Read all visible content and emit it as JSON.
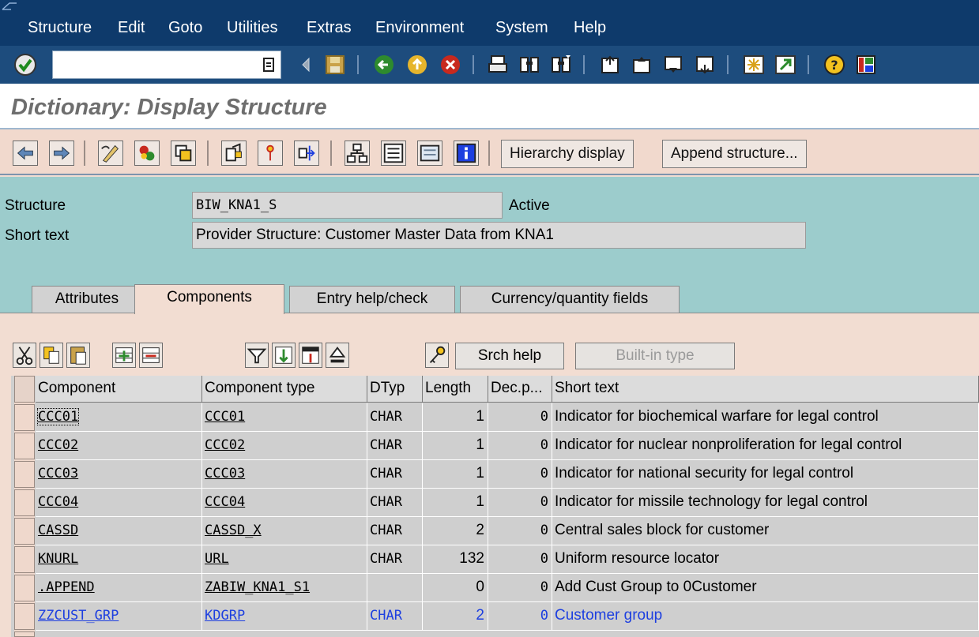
{
  "menu": {
    "items": [
      "Structure",
      "Edit",
      "Goto",
      "Utilities",
      "Extras",
      "Environment",
      "System",
      "Help"
    ]
  },
  "title": "Dictionary: Display Structure",
  "app_toolbar": {
    "hierarchy_label": "Hierarchy display",
    "append_label": "Append structure..."
  },
  "header": {
    "structure_label": "Structure",
    "structure_value": "BIW_KNA1_S",
    "status": "Active",
    "short_text_label": "Short text",
    "short_text_value": "Provider Structure: Customer Master Data from KNA1"
  },
  "tabs": [
    "Attributes",
    "Components",
    "Entry help/check",
    "Currency/quantity fields"
  ],
  "table_toolbar": {
    "srch_help_label": "Srch help",
    "builtin_type_label": "Built-in type"
  },
  "columns": [
    "Component",
    "Component type",
    "DTyp",
    "Length",
    "Dec.p...",
    "Short text"
  ],
  "rows": [
    {
      "component": "CCC01",
      "type": "CCC01",
      "dtyp": "CHAR",
      "length": "1",
      "dec": "0",
      "text": "Indicator for biochemical warfare for legal control"
    },
    {
      "component": "CCC02",
      "type": "CCC02",
      "dtyp": "CHAR",
      "length": "1",
      "dec": "0",
      "text": "Indicator for nuclear nonproliferation for legal control"
    },
    {
      "component": "CCC03",
      "type": "CCC03",
      "dtyp": "CHAR",
      "length": "1",
      "dec": "0",
      "text": "Indicator for national security for legal control"
    },
    {
      "component": "CCC04",
      "type": "CCC04",
      "dtyp": "CHAR",
      "length": "1",
      "dec": "0",
      "text": "Indicator for missile technology for legal control"
    },
    {
      "component": "CASSD",
      "type": "CASSD_X",
      "dtyp": "CHAR",
      "length": "2",
      "dec": "0",
      "text": "Central sales block for customer"
    },
    {
      "component": "KNURL",
      "type": "URL",
      "dtyp": "CHAR",
      "length": "132",
      "dec": "0",
      "text": "Uniform resource locator"
    },
    {
      "component": ".APPEND",
      "type": "ZABIW_KNA1_S1",
      "dtyp": "",
      "length": "0",
      "dec": "0",
      "text": "Add Cust Group to 0Customer"
    },
    {
      "component": "ZZCUST_GRP",
      "type": "KDGRP",
      "dtyp": "CHAR",
      "length": "2",
      "dec": "0",
      "text": "Customer group"
    }
  ],
  "colors": {
    "menubar": "#0e3a6b",
    "toolbar": "#1d4c7d",
    "header_bg": "#9ccccc",
    "body_bg": "#f2ddd2",
    "link_blue": "#1d3fe0"
  }
}
